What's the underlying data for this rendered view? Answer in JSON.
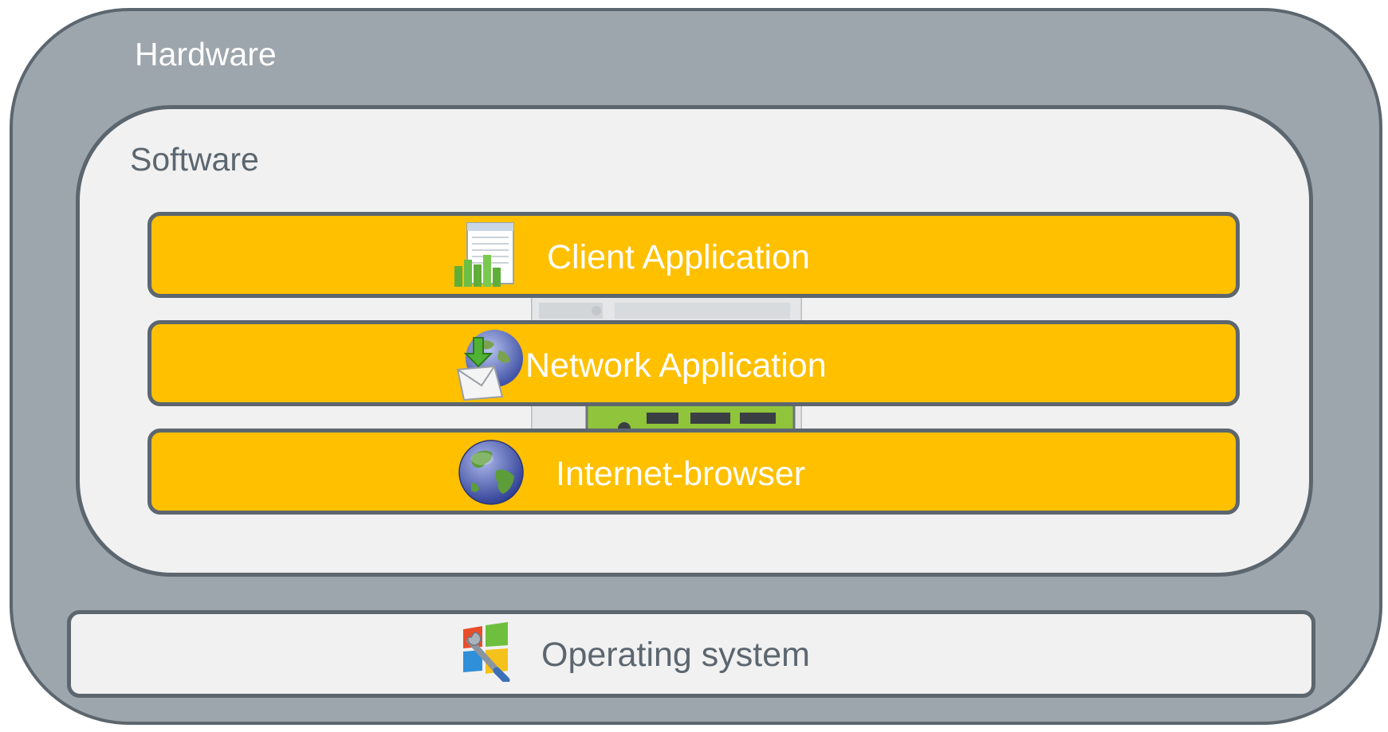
{
  "hardware": {
    "label": "Hardware"
  },
  "software": {
    "label": "Software"
  },
  "layers": [
    {
      "label": "Client Application",
      "icon": "spreadsheet-chart-icon"
    },
    {
      "label": "Network Application",
      "icon": "globe-mail-download-icon"
    },
    {
      "label": "Internet-browser",
      "icon": "globe-icon"
    }
  ],
  "operating_system": {
    "label": "Operating system",
    "icon": "windows-tools-icon"
  },
  "colors": {
    "hardware_fill": "#9da5ad",
    "border": "#5c666f",
    "software_fill": "#f1f1f1",
    "layer_fill": "#ffc000",
    "layer_text": "#ffffff",
    "os_text": "#5c666f"
  }
}
